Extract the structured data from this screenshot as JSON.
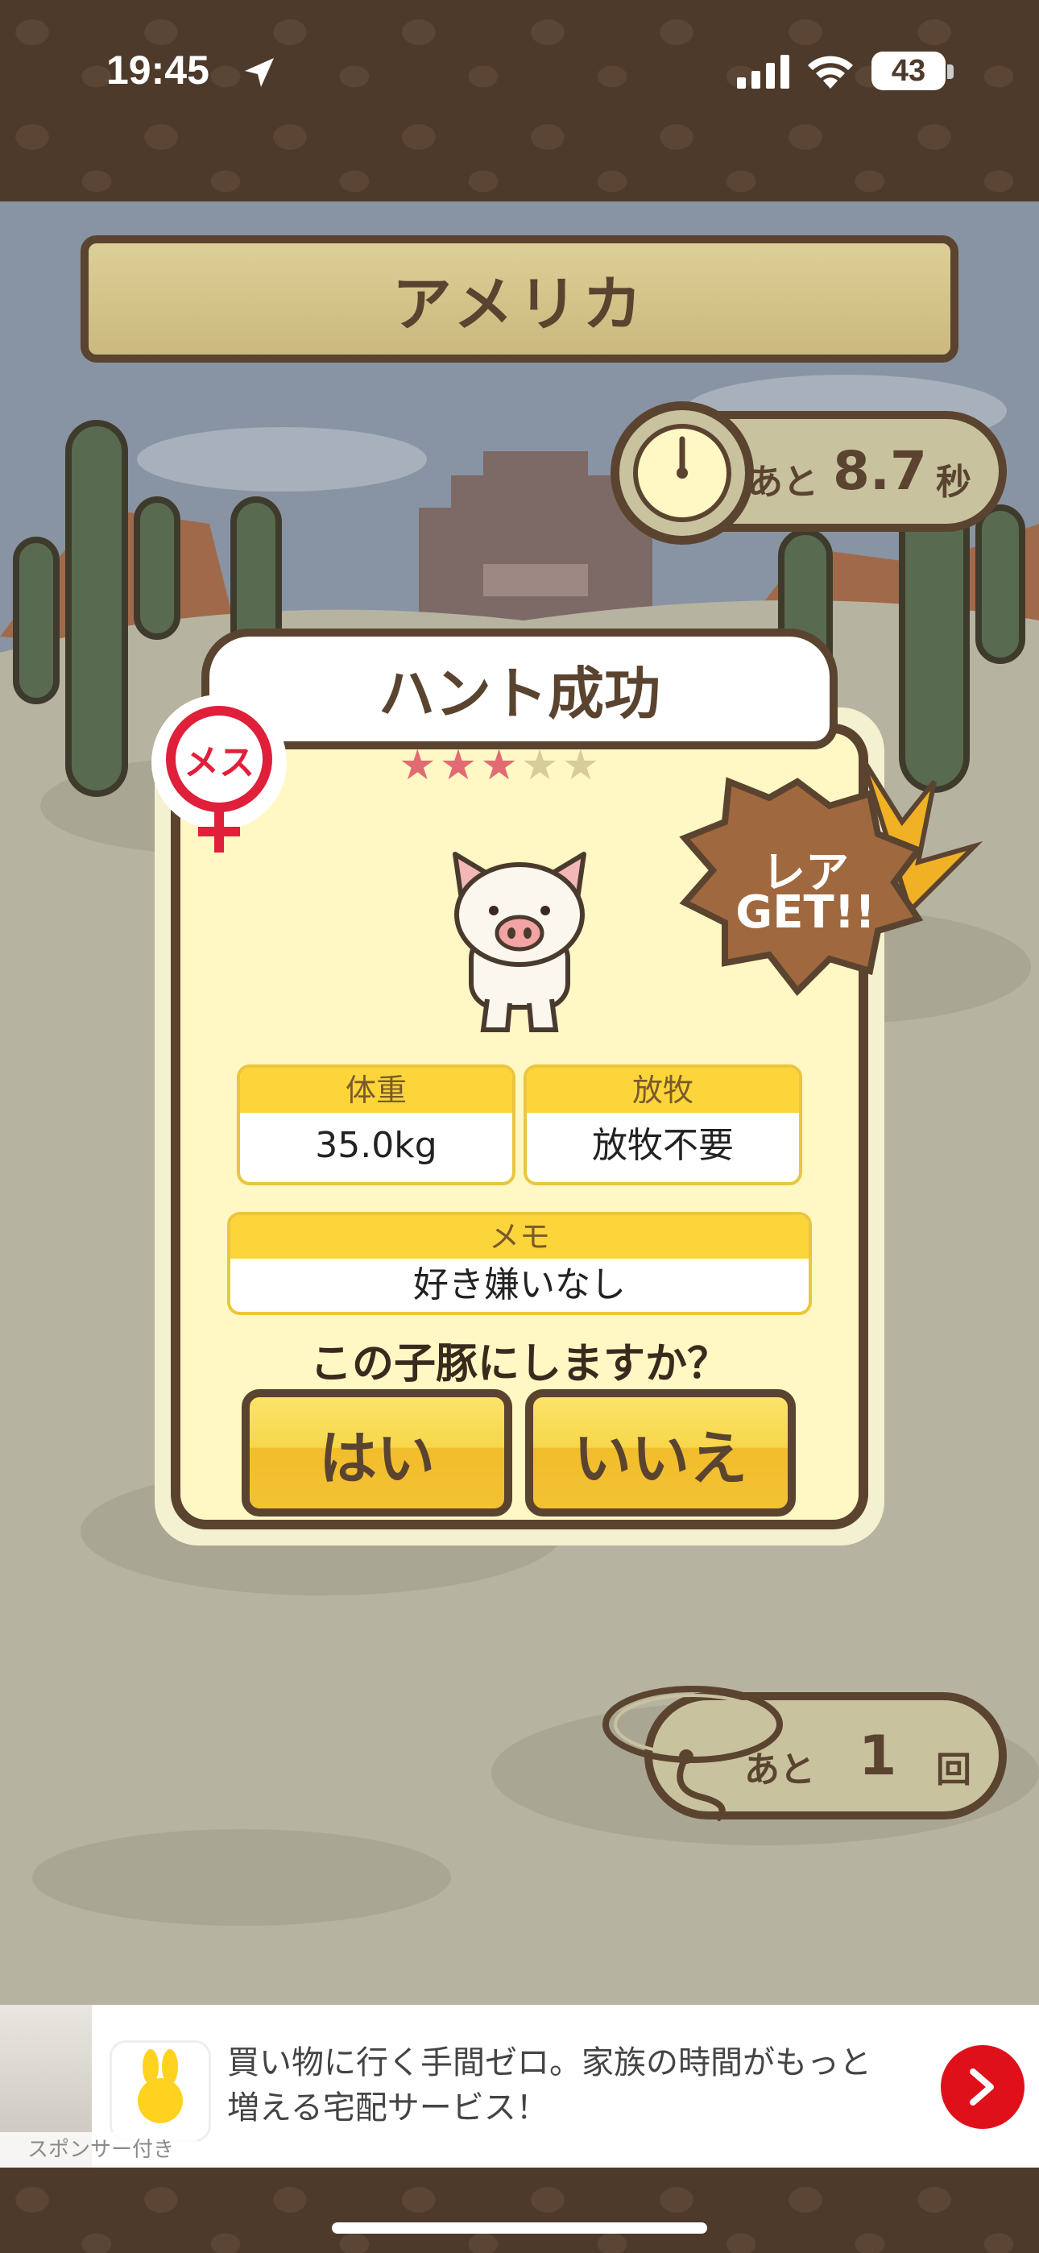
{
  "status": {
    "time": "19:45",
    "battery": "43"
  },
  "location": {
    "title": "アメリカ"
  },
  "timer": {
    "prefix": "あと",
    "value": "8.7",
    "unit": "秒"
  },
  "result": {
    "title": "ハント成功",
    "gender_badge": "メス",
    "rarity_total": 5,
    "rarity_filled": 3,
    "rare_badge_line1": "レア",
    "rare_badge_line2": "GET!!",
    "weight_label": "体重",
    "weight_value": "35.0kg",
    "grazing_label": "放牧",
    "grazing_value": "放牧不要",
    "memo_label": "メモ",
    "memo_value": "好き嫌いなし",
    "question": "この子豚にしますか？",
    "yes_label": "はい",
    "no_label": "いいえ"
  },
  "attempts": {
    "prefix": "あと",
    "value": "1",
    "unit": "回"
  },
  "ad": {
    "text_line1": "買い物に行く手間ゼロ。家族の時間がもっと",
    "text_line2": "増える宅配サービス！",
    "sponsor": "スポンサー付き"
  },
  "colors": {
    "brown": "#5a4430",
    "card": "#fff8c4",
    "yellow": "#fcd53b",
    "female_red": "#e0203a",
    "ad_arrow": "#e0101b"
  }
}
